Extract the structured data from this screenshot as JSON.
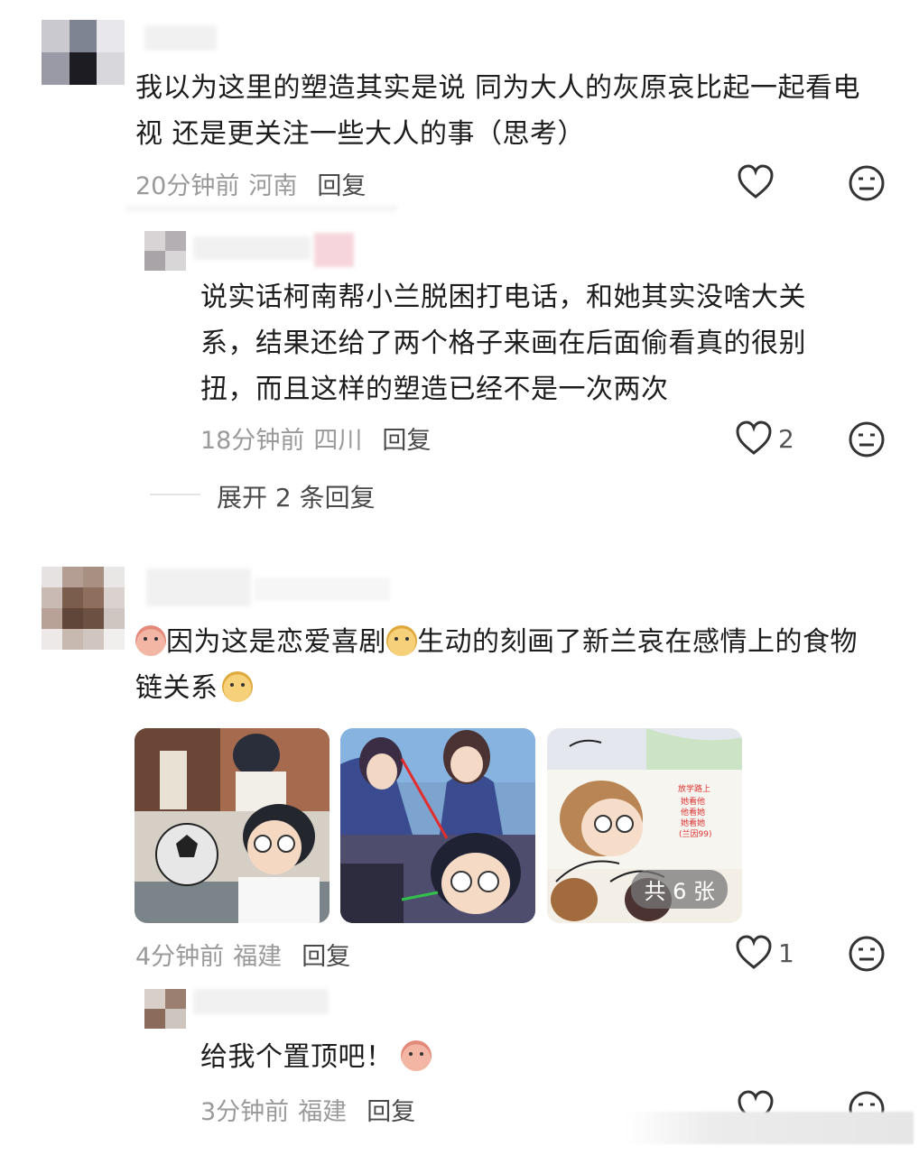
{
  "comments": [
    {
      "text": "我以为这里的塑造其实是说 同为大人的灰原哀比起一起看电视 还是更关注一些大人的事（思考）",
      "time": "20分钟前",
      "location": "河南",
      "reply_label": "回复"
    },
    {
      "text": "说实话柯南帮小兰脱困打电话，和她其实没啥大关系，结果还给了两个格子来画在后面偷看真的很别扭，而且这样的塑造已经不是一次两次",
      "time": "18分钟前",
      "location": "四川",
      "reply_label": "回复",
      "likes": "2"
    },
    {
      "text_a": "因为这是恋爱喜剧",
      "text_b": "生动的刻画了新兰哀在感情上的食物链关系",
      "time": "4分钟前",
      "location": "福建",
      "reply_label": "回复",
      "likes": "1",
      "image_count": "共 6 张"
    },
    {
      "text": "给我个置顶吧！",
      "time": "3分钟前",
      "location": "福建",
      "reply_label": "回复"
    }
  ],
  "expand_replies": "展开 2 条回复",
  "image_text": {
    "caption": [
      "放学路上",
      "她看他",
      "他看她",
      "她看她",
      "(兰因99)"
    ]
  },
  "icons": [
    "heart-icon",
    "neutral-face-icon",
    "pig-emoji",
    "dog-emoji"
  ],
  "colors": {
    "text": "#1d1d1d",
    "meta": "#9a9a9a",
    "reply": "#4a4a4a",
    "icon": "#333333"
  }
}
